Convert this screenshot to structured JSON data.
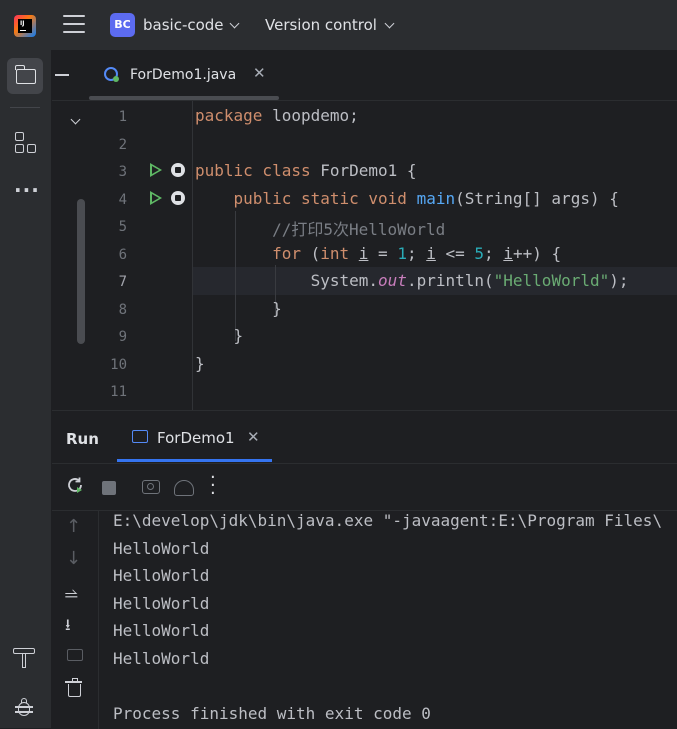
{
  "header": {
    "project_badge": "BC",
    "project_name": "basic-code",
    "vcs_label": "Version control"
  },
  "editor": {
    "tab_label": "ForDemo1.java",
    "tab_close": "✕",
    "line_numbers": [
      "1",
      "2",
      "3",
      "4",
      "5",
      "6",
      "7",
      "8",
      "9",
      "10",
      "11"
    ],
    "current_line": 7
  },
  "code_lines": [
    [
      "package",
      " loopdemo;"
    ],
    [],
    [
      "public class",
      " ForDemo1 {"
    ],
    [
      "    ",
      "public static void",
      " ",
      "main",
      "(String[] args) {"
    ],
    [
      "        ",
      "//打印5次HelloWorld"
    ],
    [
      "        ",
      "for",
      " (",
      "int",
      " ",
      "i",
      " = ",
      "1",
      "; ",
      "i",
      " <= ",
      "5",
      "; ",
      "i",
      "++) {"
    ],
    [
      "            System.",
      "out",
      ".println(",
      "\"HelloWorld\"",
      ");"
    ],
    [
      "        }"
    ],
    [
      "    }"
    ],
    [
      "}"
    ],
    []
  ],
  "run_panel": {
    "title": "Run",
    "tab_label": "ForDemo1",
    "tab_close": "✕",
    "output": [
      "E:\\develop\\jdk\\bin\\java.exe \"-javaagent:E:\\Program Files\\",
      "HelloWorld",
      "HelloWorld",
      "HelloWorld",
      "HelloWorld",
      "HelloWorld",
      "",
      "Process finished with exit code 0"
    ]
  },
  "icons": {
    "ide_logo": "intellij-logo",
    "main_menu": "hamburger-icon",
    "project": "folder-icon",
    "structure": "structure-icon",
    "more": "more-icon",
    "build": "hammer-icon",
    "debug": "bug-icon"
  },
  "colors": {
    "background": "#1e1f22",
    "panel": "#2b2d30",
    "keyword": "#cf8e6d",
    "function": "#56a8f5",
    "number": "#2aacb8",
    "string": "#6aab73",
    "comment": "#7a7e85",
    "static_field": "#c77dbb",
    "run_green": "#5fb865",
    "accent": "#3574f0"
  }
}
